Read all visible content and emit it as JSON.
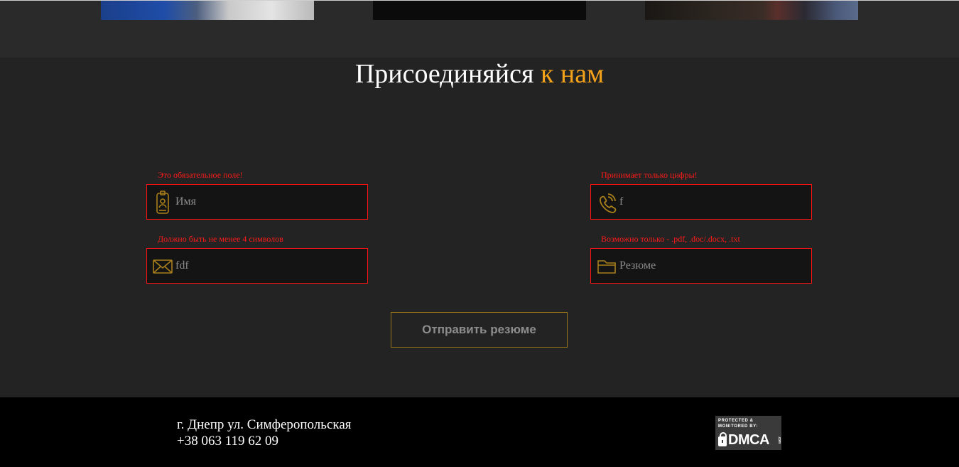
{
  "join": {
    "title_main": "Присоединяйся",
    "title_accent": "к нам",
    "fields": {
      "name": {
        "placeholder": "Имя",
        "value": "",
        "error": "Это обязательное поле!",
        "icon": "id-badge-icon"
      },
      "phone": {
        "placeholder": "",
        "value": "f",
        "error": "Принимает только цифры!",
        "icon": "phone-icon"
      },
      "email": {
        "placeholder": "",
        "value": "fdf",
        "error": "Должно быть не менее 4 символов",
        "icon": "envelope-icon"
      },
      "resume": {
        "placeholder": "Резюме",
        "value": "",
        "error": "Возможно только - .pdf, .doc/.docx, .txt",
        "icon": "folder-icon"
      }
    },
    "submit_label": "Отправить резюме"
  },
  "footer": {
    "address": "г. Днепр ул. Симферопольская",
    "phone": "+38 063 119 62 09",
    "dmca_small_1": "PROTECTED &",
    "dmca_small_2": "MONITORED BY:",
    "dmca_big": "DMCA",
    "dmca_side": ".com"
  },
  "colors": {
    "background": "#232323",
    "accent": "#f5a21b",
    "error": "#ff1a1a",
    "icon": "#a87f1b",
    "button_border": "#9a7418",
    "footer": "#000000"
  }
}
